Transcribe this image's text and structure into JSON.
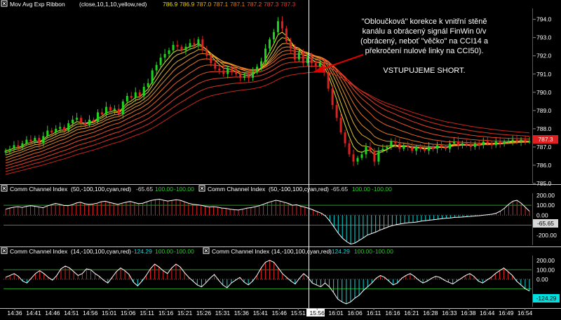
{
  "chart_data": [
    {
      "type": "candlestick",
      "indicator_label": "Mov Avg Exp Ribbon",
      "indicator_params": "(close,10,1,10,yellow,red)",
      "ribbon_values": [
        "786.9",
        "786.9",
        "787.0",
        "787.1",
        "787.1",
        "787.2",
        "787.3",
        "787.3"
      ],
      "ribbon_value_colors": [
        "#f0e000",
        "#f0d000",
        "#f0b800",
        "#f09a00",
        "#f07a00",
        "#f05a20",
        "#f04040",
        "#f03030"
      ],
      "y_ticks": [
        "794.0",
        "793.0",
        "792.0",
        "791.0",
        "790.0",
        "789.0",
        "788.0",
        "787.0",
        "786.0",
        "785.0"
      ],
      "ylim": [
        785,
        794.6
      ],
      "last_price_marker": "787.3",
      "last_price_value": 787.3,
      "candle_colors": {
        "up": "#1fd41f",
        "down": "#e02020"
      },
      "annotation_lines": [
        "\"Obloučková\" korekce k vnitřní stěně",
        "kanálu a obrácený signál FinWin 0/v",
        "(obrácený, neboť \"věčko\" na CCI14 a",
        "překročení nulové linky na CCI50).",
        "",
        "VSTUPUJEME SHORT."
      ],
      "close": [
        786.8,
        786.9,
        787.1,
        787.0,
        787.2,
        787.4,
        787.3,
        787.5,
        787.2,
        787.6,
        787.9,
        787.8,
        788.0,
        788.1,
        787.9,
        788.3,
        788.5,
        788.6,
        788.3,
        788.2,
        788.5,
        788.4,
        788.9,
        788.8,
        789.2,
        789.0,
        789.1,
        788.8,
        789.5,
        789.8,
        789.7,
        790.0,
        789.8,
        790.3,
        790.5,
        791.2,
        791.5,
        791.9,
        792.1,
        792.3,
        792.6,
        792.5,
        792.3,
        792.5,
        792.7,
        792.6,
        792.9,
        792.3,
        792.0,
        791.6,
        791.3,
        791.2,
        791.0,
        791.3,
        791.1,
        791.0,
        790.8,
        790.9,
        790.8,
        791.1,
        791.4,
        791.7,
        792.4,
        792.9,
        793.3,
        793.9,
        793.5,
        792.8,
        792.4,
        791.8,
        792.2,
        791.6,
        791.9,
        791.6,
        791.4,
        791.6,
        791.1,
        790.2,
        789.3,
        788.6,
        787.8,
        787.2,
        786.6,
        786.2,
        786.4,
        786.6,
        787.0,
        786.8,
        786.2,
        786.8,
        786.9,
        787.0,
        787.3,
        787.2,
        786.9,
        787.1,
        787.0,
        786.8,
        787.0,
        786.9,
        786.8,
        787.0,
        786.9,
        787.1,
        787.0,
        786.9,
        787.2,
        787.3,
        787.1,
        787.2,
        787.1,
        787.0,
        787.2,
        787.1,
        787.3,
        787.2,
        787.1,
        787.3,
        787.2,
        787.3,
        787.3,
        787.4,
        787.3,
        787.4,
        787.3,
        787.3
      ]
    },
    {
      "type": "histogram",
      "indicator_label": "Comm Channel Index",
      "indicator_params": "(50,-100,100,cyan,red)",
      "values_left": [
        "-65.65",
        "100.00",
        "-100.00"
      ],
      "values_right": [
        "-65.65",
        "100.00",
        "-100.00"
      ],
      "value_colors": [
        "#d8d8d8",
        "#1fd41f",
        "#1fd41f"
      ],
      "y_ticks": [
        "200.00",
        "100.00",
        "0.00",
        "-200.00"
      ],
      "last_value_marker": "-65.65",
      "ylim": [
        -300,
        220
      ],
      "thresholds": [
        100,
        -100
      ],
      "colors": {
        "above": "#e02020",
        "below": "#00e0e0",
        "mid": "#d0d0d0",
        "line": "#ffffff"
      },
      "values": [
        60,
        72,
        80,
        85,
        78,
        88,
        95,
        90,
        82,
        75,
        92,
        105,
        118,
        110,
        98,
        95,
        105,
        122,
        130,
        115,
        108,
        112,
        120,
        135,
        140,
        128,
        118,
        108,
        120,
        130,
        138,
        126,
        115,
        120,
        135,
        148,
        155,
        160,
        150,
        142,
        148,
        155,
        150,
        135,
        120,
        110,
        105,
        100,
        90,
        82,
        85,
        80,
        72,
        68,
        60,
        55,
        52,
        60,
        70,
        76,
        84,
        95,
        110,
        125,
        138,
        150,
        142,
        130,
        118,
        100,
        105,
        90,
        80,
        68,
        52,
        35,
        18,
        -10,
        -60,
        -120,
        -180,
        -230,
        -265,
        -290,
        -280,
        -255,
        -228,
        -200,
        -185,
        -170,
        -150,
        -135,
        -118,
        -105,
        -95,
        -88,
        -80,
        -75,
        -72,
        -68,
        -60,
        -55,
        -50,
        -45,
        -40,
        -35,
        -30,
        -28,
        -22,
        -20,
        -18,
        -15,
        -12,
        -8,
        -5,
        0,
        5,
        10,
        20,
        40,
        70,
        110,
        140,
        150,
        120,
        80,
        40
      ]
    },
    {
      "type": "histogram",
      "indicator_label": "Comm Channel Index",
      "indicator_params": "(14,-100,100,cyan,red)",
      "values_left": [
        "-124.29",
        "100.00",
        "-100.00"
      ],
      "values_right": [
        "-124.29",
        "100.00",
        "-100.00"
      ],
      "value_colors": [
        "#00e0e0",
        "#1fd41f",
        "#1fd41f"
      ],
      "y_ticks": [
        "200.00",
        "100.00",
        "0.00",
        "-200.00"
      ],
      "last_value_marker": "-124.29",
      "ylim": [
        -290,
        250
      ],
      "thresholds": [
        100,
        -100
      ],
      "colors": {
        "above": "#e02020",
        "below": "#00e0e0",
        "mid": "#d0d0d0",
        "line": "#ffffff"
      },
      "values": [
        20,
        40,
        60,
        30,
        -20,
        -40,
        10,
        60,
        90,
        60,
        20,
        -10,
        40,
        110,
        140,
        120,
        80,
        40,
        60,
        110,
        100,
        60,
        30,
        -10,
        -40,
        20,
        80,
        120,
        90,
        50,
        -30,
        -70,
        -20,
        40,
        110,
        160,
        130,
        90,
        60,
        120,
        160,
        130,
        70,
        20,
        -20,
        -60,
        -80,
        -40,
        10,
        50,
        -10,
        -60,
        -90,
        -40,
        -10,
        20,
        -30,
        -60,
        -20,
        40,
        120,
        180,
        200,
        180,
        120,
        60,
        20,
        -20,
        -50,
        10,
        60,
        20,
        -40,
        -60,
        -80,
        -40,
        -80,
        -140,
        -210,
        -240,
        -260,
        -240,
        -200,
        -170,
        -120,
        -80,
        -40,
        10,
        40,
        20,
        -20,
        -60,
        -40,
        10,
        40,
        60,
        30,
        -10,
        -40,
        -20,
        10,
        30,
        20,
        -10,
        -30,
        -50,
        -20,
        10,
        40,
        60,
        30,
        -20,
        -40,
        -10,
        20,
        60,
        90,
        120,
        80,
        40,
        -20,
        -60,
        -100,
        -124
      ]
    }
  ],
  "x_axis_labels": [
    "14:36",
    "14:41",
    "14:46",
    "14:51",
    "14:56",
    "15:01",
    "15:06",
    "15:11",
    "15:16",
    "15:21",
    "15:26",
    "15:31",
    "15:36",
    "15:41",
    "15:46",
    "15:51",
    "15:56",
    "16:01",
    "16:06",
    "16:11",
    "16:16",
    "16:21",
    "16:28",
    "16:33",
    "16:38",
    "16:44",
    "16:49",
    "16:54"
  ],
  "x_axis_highlight": "15:56",
  "colors": {
    "background": "#000000",
    "axis_line": "#5a5a5a",
    "label_box": "#ffffff",
    "annotation_text": "#ffffff",
    "arrow": "#e00000",
    "cursor_line": "#ffffff"
  }
}
